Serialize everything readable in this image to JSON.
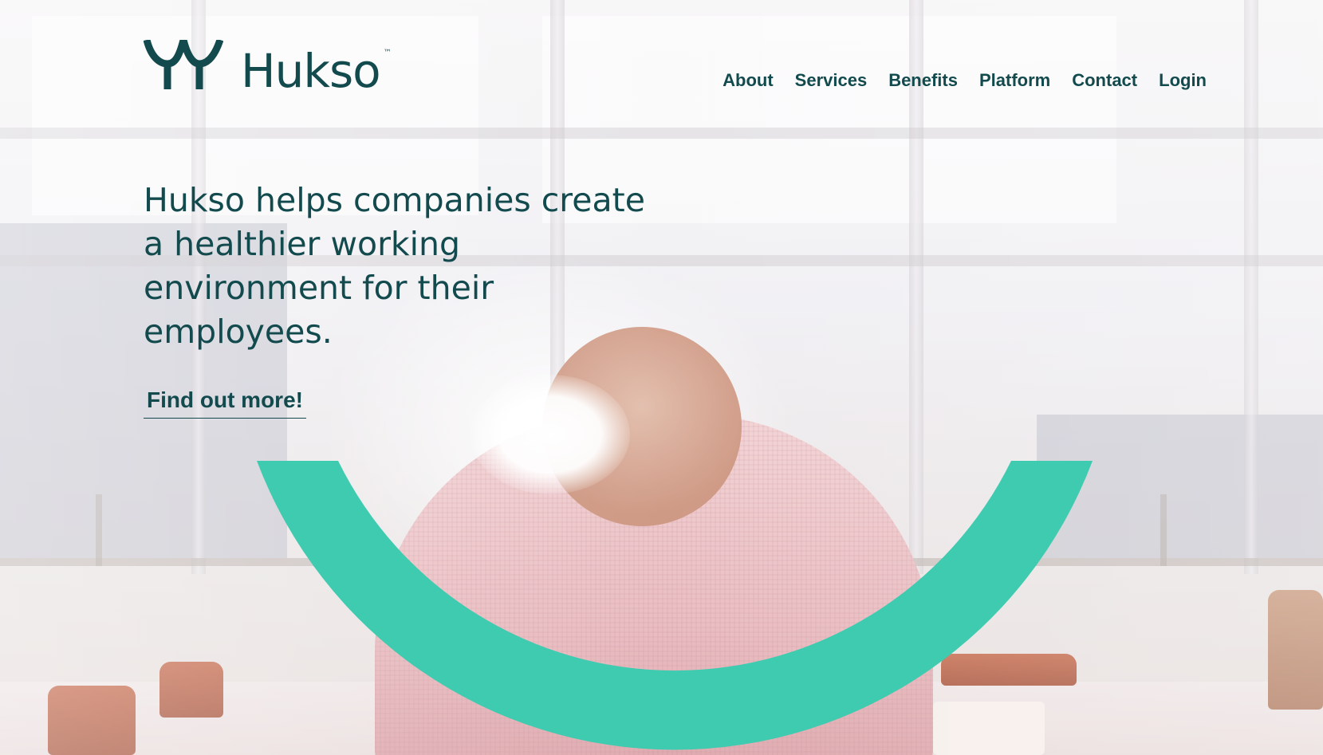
{
  "brand": {
    "name": "Hukso",
    "trademark": "™",
    "color": "#124a4e",
    "logo_icon": "hukso-mark-icon"
  },
  "nav": {
    "items": [
      {
        "label": "About"
      },
      {
        "label": "Services"
      },
      {
        "label": "Benefits"
      },
      {
        "label": "Platform"
      },
      {
        "label": "Contact"
      },
      {
        "label": "Login"
      }
    ]
  },
  "hero": {
    "heading": "Hukso helps companies create a healthier working environment for their employees.",
    "cta_label": "Find out more!",
    "background_image": "office-worker-at-window-photo",
    "accent_color": "#3ecbb0",
    "smile_icon": "smile-arc-icon"
  }
}
